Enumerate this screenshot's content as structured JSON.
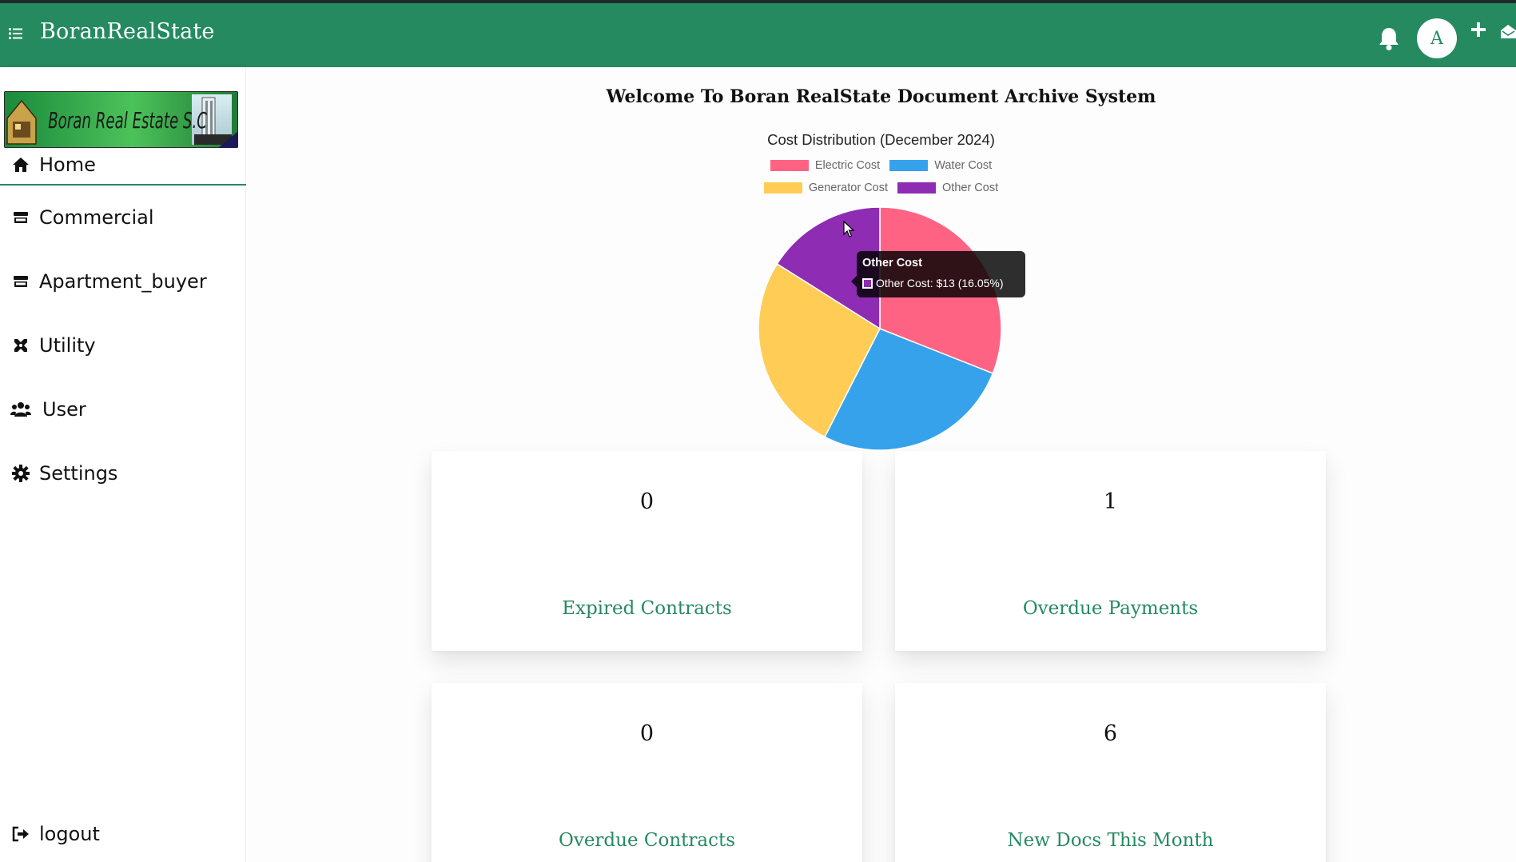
{
  "app": {
    "title": "BoranRealState"
  },
  "header": {
    "avatar_letter": "A"
  },
  "sidebar": {
    "logo_text": "Boran Real Estate S.C",
    "items": [
      {
        "label": "Home",
        "icon": "home-icon"
      },
      {
        "label": "Commercial",
        "icon": "store-icon"
      },
      {
        "label": "Apartment_buyer",
        "icon": "store-icon"
      },
      {
        "label": "Utility",
        "icon": "tools-icon"
      },
      {
        "label": "User",
        "icon": "users-icon"
      },
      {
        "label": "Settings",
        "icon": "gear-icon"
      }
    ],
    "logout_label": "logout"
  },
  "main": {
    "welcome": "Welcome To Boran RealState Document Archive System"
  },
  "chart_data": {
    "type": "pie",
    "title": "Cost Distribution (December 2024)",
    "categories": [
      "Electric Cost",
      "Water Cost",
      "Generator Cost",
      "Other Cost"
    ],
    "values": [
      31.0,
      26.5,
      26.45,
      16.05
    ],
    "colors": [
      "#ff6384",
      "#36a2eb",
      "#ffcd56",
      "#8e2cb3"
    ],
    "legend": "top",
    "tooltip": {
      "title": "Other Cost",
      "text": "Other Cost: $13 (16.05%)"
    }
  },
  "cards": [
    {
      "value": "0",
      "label": "Expired Contracts"
    },
    {
      "value": "1",
      "label": "Overdue Payments"
    },
    {
      "value": "0",
      "label": "Overdue Contracts"
    },
    {
      "value": "6",
      "label": "New Docs This Month"
    }
  ]
}
